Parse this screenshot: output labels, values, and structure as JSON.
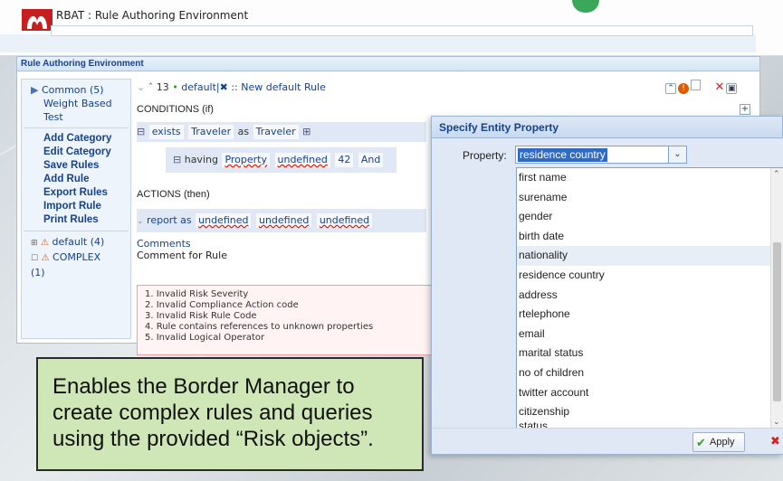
{
  "window": {
    "title": "RBAT : Rule Authoring Environment"
  },
  "panel": {
    "title": "Rule Authoring Environment"
  },
  "sidebar": {
    "nav": [
      {
        "label": "Common (5)"
      },
      {
        "label": "Weight Based"
      },
      {
        "label": "Test"
      }
    ],
    "actions": [
      {
        "label": "Add Category"
      },
      {
        "label": "Edit Category"
      },
      {
        "label": "Save Rules"
      },
      {
        "label": "Add Rule"
      },
      {
        "label": "Export Rules"
      },
      {
        "label": "Import Rule"
      },
      {
        "label": "Print Rules"
      }
    ],
    "rulesets": [
      {
        "label": "default (4)"
      },
      {
        "label": "COMPLEX (1)"
      }
    ]
  },
  "rule": {
    "number": "13",
    "name": "default|✖ :: New default Rule",
    "conditions_header": "CONDITIONS (if)",
    "exists": "exists",
    "entity": "Traveler",
    "as": "as",
    "alias": "Traveler",
    "having": "having",
    "property": "Property",
    "operator": "undefined",
    "value": "42",
    "logic": "And",
    "actions_header": "ACTIONS (then)",
    "report_as": "report as",
    "action_args": [
      "undefined",
      "undefined",
      "undefined"
    ],
    "comments_label": "Comments",
    "comment_text": "Comment for Rule",
    "errors": [
      "1. Invalid Risk Severity",
      "2. Invalid Compliance Action code",
      "3. Invalid Risk Rule Code",
      "4. Rule contains references to unknown properties",
      "5. Invalid Logical Operator"
    ]
  },
  "dialog": {
    "title": "Specify Entity Property",
    "property_label": "Property:",
    "selected": "residence country",
    "options": [
      "first name",
      "surename",
      "gender",
      "birth date",
      "nationality",
      "residence country",
      "address",
      "rtelephone",
      "email",
      "marital status",
      "no of children",
      "twitter account",
      "citizenship",
      "status"
    ],
    "apply_label": "Apply"
  },
  "caption": {
    "text": "Enables the Border Manager to create complex rules and queries using the provided “Risk objects”."
  },
  "colors": {
    "accent": "#15428b",
    "selection": "#316ac5",
    "caption_bg": "#cfe6b6",
    "error_bg": "#fff3f3"
  }
}
